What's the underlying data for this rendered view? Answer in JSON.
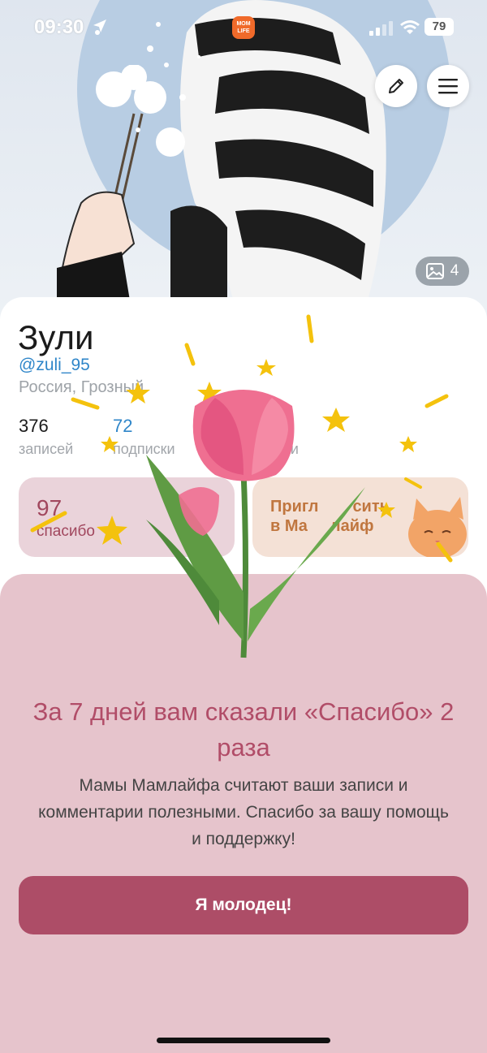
{
  "status_bar": {
    "time": "09:30",
    "app_badge": "MOM LIFE",
    "battery": "79"
  },
  "header": {
    "photos_count": "4"
  },
  "profile": {
    "name": "Зули",
    "handle": "@zuli_95",
    "location": "Россия, Грозный",
    "stats": {
      "posts_count": "376",
      "posts_label": "записей",
      "subs_count": "72",
      "subs_label": "подписки",
      "followers_label": "ики"
    }
  },
  "cards": {
    "thanks_count": "97",
    "thanks_label": "спасибо",
    "invite_line1": "Пригл",
    "invite_line1b": "сить",
    "invite_line2": "в Ма",
    "invite_line2b": "лайф"
  },
  "modal": {
    "title": "За 7 дней вам сказали «Спасибо» 2 раза",
    "text": "Мамы Мамлайфа считают ваши записи и комментарии полезными. Спасибо за вашу помощь и поддержку!",
    "button": "Я молодец!"
  },
  "icons": {
    "edit": "pencil-icon",
    "menu": "hamburger-icon",
    "photos": "image-icon"
  },
  "colors": {
    "accent": "#ad4d67",
    "sheet_bg": "#e6c4cc",
    "link": "#2f86c9"
  }
}
